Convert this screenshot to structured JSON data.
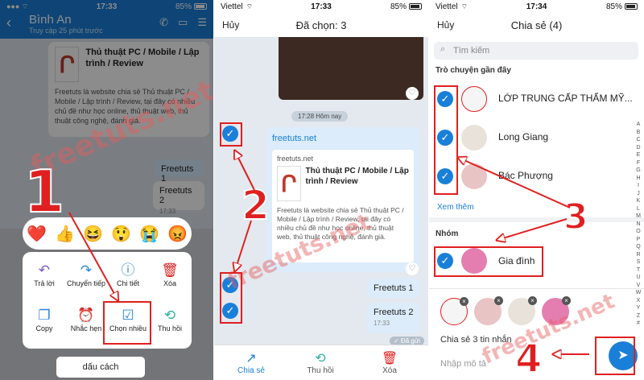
{
  "panel1": {
    "status": {
      "carrier": "",
      "time": "17:33",
      "battery": "85%"
    },
    "header": {
      "back": "‹",
      "title": "Bình An",
      "subtitle": "Truy cập 25 phút trước"
    },
    "link_card": {
      "title": "Thủ thuật PC / Mobile / Lập trình / Review",
      "desc": "Freetuts là website chia sẻ Thủ thuật PC / Mobile / Lập trình / Review, tại đây có nhiều chủ đề như học online, thủ thuật web, thủ thuật công nghệ, đánh giá."
    },
    "messages": [
      {
        "text": "Freetuts 1",
        "time": ""
      },
      {
        "text": "Freetuts 2",
        "time": "17:33"
      }
    ],
    "reactions": [
      "❤️",
      "👍",
      "😆",
      "😲",
      "😭",
      "😡"
    ],
    "menu": [
      {
        "label": "Trả lời",
        "icon": "reply-icon"
      },
      {
        "label": "Chuyển tiếp",
        "icon": "forward-icon"
      },
      {
        "label": "Chi tiết",
        "icon": "info-icon"
      },
      {
        "label": "Xóa",
        "icon": "trash-icon"
      },
      {
        "label": "Copy",
        "icon": "copy-icon"
      },
      {
        "label": "Nhắc hẹn",
        "icon": "alarm-icon"
      },
      {
        "label": "Chọn nhiều",
        "icon": "multi-select-icon"
      },
      {
        "label": "Thu hồi",
        "icon": "undo-icon"
      }
    ],
    "keyboard_space": "dấu cách",
    "step": "1"
  },
  "panel2": {
    "status": {
      "carrier": "Viettel",
      "time": "17:33",
      "battery": "85%"
    },
    "header": {
      "cancel": "Hủy",
      "title": "Đã chọn: 3"
    },
    "time_pill": "17:28 Hôm nay",
    "link_card": {
      "url": "freetuts.net",
      "domain": "freetuts.net",
      "title": "Thủ thuật PC / Mobile / Lập trình / Review",
      "desc": "Freetuts là website chia sẻ Thủ thuật PC / Mobile / Lập trình / Review, tại đây có nhiều chủ đề như học online, thủ thuật web, thủ thuật công nghệ, đánh giá."
    },
    "messages": [
      {
        "text": "Freetuts 1"
      },
      {
        "text": "Freetuts 2",
        "time": "17:33"
      }
    ],
    "sent_label": "✓ Đã gửi",
    "bottom": {
      "share": "Chia sẻ",
      "recall": "Thu hồi",
      "delete": "Xóa"
    },
    "step": "2"
  },
  "panel3": {
    "status": {
      "carrier": "Viettel",
      "time": "17:34",
      "battery": "85%"
    },
    "header": {
      "cancel": "Hủy",
      "title": "Chia sẻ (4)"
    },
    "search_placeholder": "Tìm kiếm",
    "recent_label": "Trò chuyện gần đây",
    "recent": [
      {
        "name": "LỚP TRUNG CẤP THẨM MỸ..."
      },
      {
        "name": "Long Giang"
      },
      {
        "name": "Bác Phượng"
      }
    ],
    "see_more": "Xem thêm",
    "group_label": "Nhóm",
    "groups": [
      {
        "name": "Gia đình"
      }
    ],
    "alphabet": "A B C D E F G H I J K L M N O P Q R S T U V W X Y Z #",
    "share_count": "Chia sẻ 3 tin nhắn",
    "input_placeholder": "Nhập mô tả",
    "step3": "3",
    "step4": "4"
  },
  "watermark": "freetuts.net",
  "colors": {
    "accent": "#1a7fd8",
    "annotation": "#e02020"
  }
}
